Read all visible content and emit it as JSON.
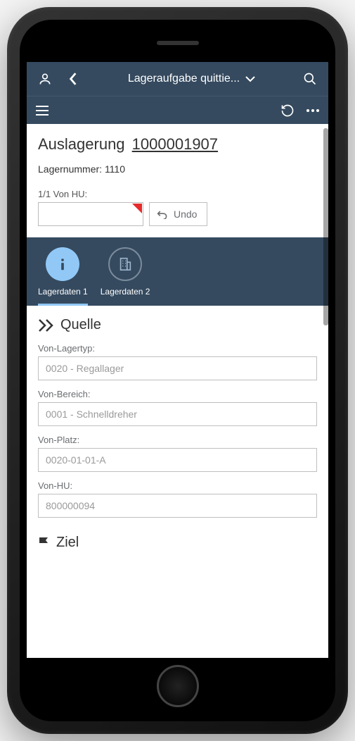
{
  "header": {
    "title": "Lageraufgabe quittie..."
  },
  "doc": {
    "type": "Auslagerung",
    "number": "1000001907",
    "warehouse_label": "Lagernummer:",
    "warehouse_value": "1110"
  },
  "hu": {
    "counter_label": "1/1 Von HU:",
    "value": "",
    "undo_label": "Undo"
  },
  "tabs": [
    {
      "label": "Lagerdaten 1"
    },
    {
      "label": "Lagerdaten 2"
    }
  ],
  "quelle": {
    "title": "Quelle",
    "fields": [
      {
        "label": "Von-Lagertyp:",
        "value": "0020 - Regallager"
      },
      {
        "label": "Von-Bereich:",
        "value": "0001 - Schnelldreher"
      },
      {
        "label": "Von-Platz:",
        "value": "0020-01-01-A"
      },
      {
        "label": "Von-HU:",
        "value": "800000094"
      }
    ]
  },
  "ziel": {
    "title": "Ziel"
  }
}
